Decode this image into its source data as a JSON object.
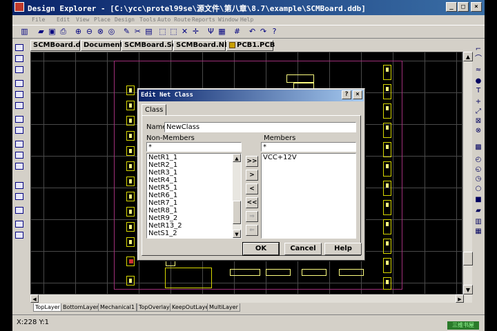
{
  "window": {
    "title": "Design Explorer - [C:\\ycc\\protel99se\\源文件\\第八章\\8.7\\example\\SCMBoard.ddb]",
    "minimize": "_",
    "maximize": "□",
    "close": "×"
  },
  "menu": [
    "File",
    "Edit",
    "View",
    "Place",
    "Design",
    "Tools",
    "Auto Route",
    "Reports",
    "Window",
    "Help"
  ],
  "doc_tabs": [
    "SCMBoard.ddb",
    "Documents",
    "SCMBoard.Sch",
    "SCMBoard.NET",
    "PCB1.PCB"
  ],
  "active_doc_tab": "PCB1.PCB",
  "layer_tabs": [
    "TopLayer",
    "BottomLayer",
    "Mechanical1",
    "TopOverlay",
    "KeepOutLayer",
    "MultiLayer"
  ],
  "status": {
    "coords": "X:228 Y:1",
    "badge": "三维书屋"
  },
  "dialog": {
    "title": "Edit Net Class",
    "help_btn": "?",
    "close_btn": "×",
    "tab": "Class",
    "name_label": "Name",
    "name_value": "NewClass",
    "non_members_label": "Non-Members",
    "members_label": "Members",
    "non_members_filter": "*",
    "members_filter": "*",
    "non_members": [
      "NetR1_1",
      "NetR2_1",
      "NetR3_1",
      "NetR4_1",
      "NetR5_1",
      "NetR6_1",
      "NetR7_1",
      "NetR8_1",
      "NetR9_2",
      "NetR13_2",
      "NetS1_2"
    ],
    "members": [
      "VCC+12V"
    ],
    "move_buttons": [
      ">>",
      ">",
      "<",
      "<<",
      "⇒",
      "⇐"
    ],
    "ok": "OK",
    "cancel": "Cancel",
    "help": "Help"
  }
}
